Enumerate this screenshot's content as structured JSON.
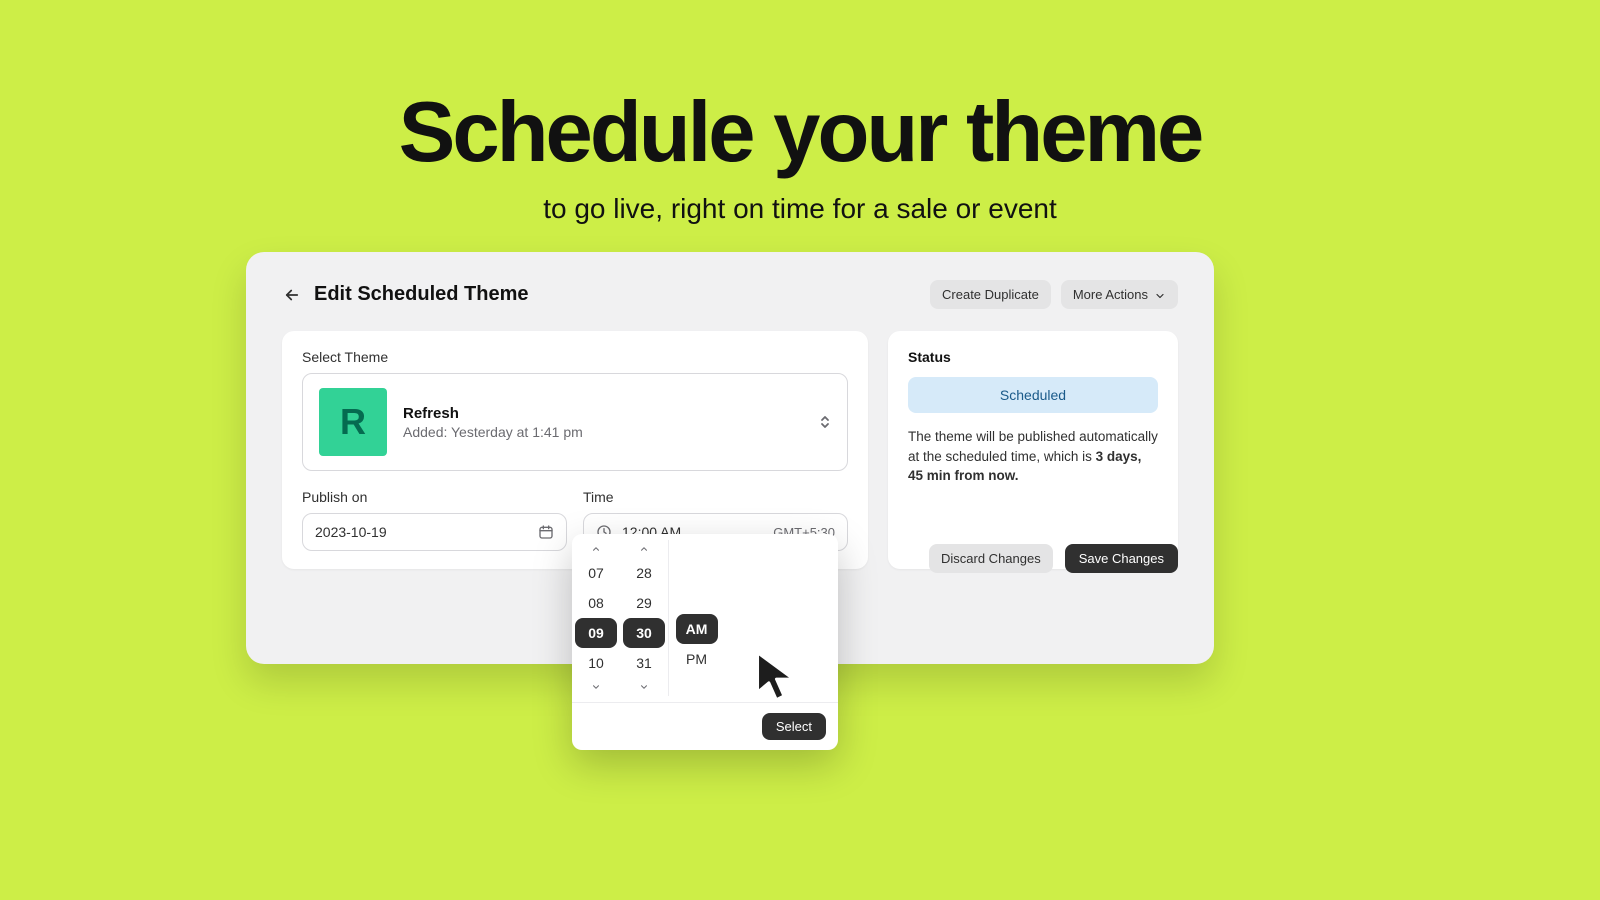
{
  "hero": {
    "title": "Schedule your theme",
    "subtitle": "to go live, right on time for a sale or event"
  },
  "header": {
    "title": "Edit Scheduled Theme",
    "duplicate": "Create Duplicate",
    "more": "More Actions"
  },
  "theme": {
    "select_label": "Select Theme",
    "thumb_letter": "R",
    "name": "Refresh",
    "added": "Added: Yesterday at 1:41 pm"
  },
  "publish": {
    "date_label": "Publish on",
    "date_value": "2023-10-19",
    "time_label": "Time",
    "time_value": "12:00 AM",
    "tz": "GMT+5:30"
  },
  "status": {
    "label": "Status",
    "pill": "Scheduled",
    "text_a": "The theme will be published automatically at the scheduled time, which is ",
    "text_b": "3 days, 45 min from now."
  },
  "footer": {
    "discard": "Discard Changes",
    "save": "Save Changes"
  },
  "picker": {
    "hours": [
      "07",
      "08",
      "09",
      "10"
    ],
    "selected_hour": "09",
    "minutes": [
      "28",
      "29",
      "30",
      "31"
    ],
    "selected_minute": "30",
    "ampm": [
      "AM",
      "PM"
    ],
    "selected_ampm": "AM",
    "select": "Select"
  }
}
